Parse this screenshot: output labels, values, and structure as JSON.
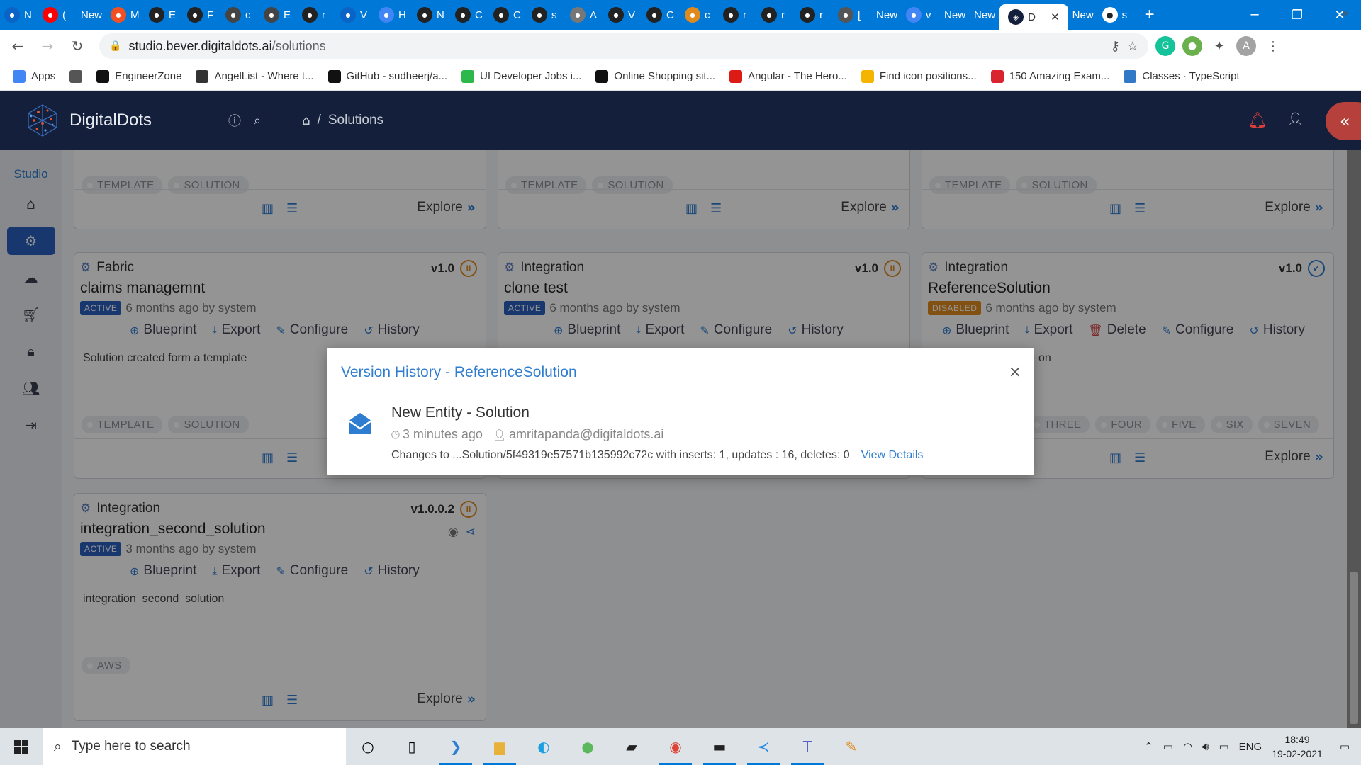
{
  "browser": {
    "tabs": [
      {
        "label": "N",
        "icon": "outlook-icon",
        "color": "#0a64c8"
      },
      {
        "label": "(",
        "icon": "youtube-icon",
        "color": "#ff0000"
      },
      {
        "label": "New",
        "icon": "none",
        "color": ""
      },
      {
        "label": "M",
        "icon": "microsoft-icon",
        "color": "#f25022"
      },
      {
        "label": "E",
        "icon": "github-icon",
        "color": "#222"
      },
      {
        "label": "F",
        "icon": "hub-icon",
        "color": "#222"
      },
      {
        "label": "c",
        "icon": "app-icon",
        "color": "#444"
      },
      {
        "label": "E",
        "icon": "table-icon",
        "color": "#444"
      },
      {
        "label": "r",
        "icon": "github-icon",
        "color": "#222"
      },
      {
        "label": "V",
        "icon": "vscode-icon",
        "color": "#0a64c8"
      },
      {
        "label": "H",
        "icon": "google-icon",
        "color": "#4285f4"
      },
      {
        "label": "N",
        "icon": "github-icon",
        "color": "#222"
      },
      {
        "label": "C",
        "icon": "github-icon",
        "color": "#222"
      },
      {
        "label": "C",
        "icon": "github-icon",
        "color": "#222"
      },
      {
        "label": "s",
        "icon": "github-icon",
        "color": "#222"
      },
      {
        "label": "A",
        "icon": "globe-icon",
        "color": "#777"
      },
      {
        "label": "V",
        "icon": "diamond-icon",
        "color": "#222"
      },
      {
        "label": "C",
        "icon": "github-icon",
        "color": "#222"
      },
      {
        "label": "c",
        "icon": "stack-icon",
        "color": "#e08a1e"
      },
      {
        "label": "r",
        "icon": "github-icon",
        "color": "#222"
      },
      {
        "label": "r",
        "icon": "github-icon",
        "color": "#222"
      },
      {
        "label": "r",
        "icon": "github-icon",
        "color": "#222"
      },
      {
        "label": "[",
        "icon": "star-icon",
        "color": "#555"
      },
      {
        "label": "New",
        "icon": "none",
        "color": ""
      },
      {
        "label": "v",
        "icon": "google-icon",
        "color": "#4285f4"
      },
      {
        "label": "New",
        "icon": "none",
        "color": ""
      },
      {
        "label": "New",
        "icon": "none",
        "color": ""
      }
    ],
    "active_tab": {
      "label": "D",
      "close": "✕"
    },
    "after_tabs": [
      {
        "label": "New",
        "icon": "none"
      },
      {
        "label": "s",
        "icon": "github-icon"
      }
    ],
    "url_host": "studio.bever.digitaldots.ai",
    "url_path": "/solutions",
    "bookmarks": [
      {
        "label": "Apps",
        "icon": "apps-icon",
        "color": "#4285f4"
      },
      {
        "label": "",
        "icon": "globe-icon",
        "color": "#555"
      },
      {
        "label": "EngineerZone",
        "icon": "play-icon",
        "color": "#111"
      },
      {
        "label": "AngelList - Where t...",
        "icon": "angel-icon",
        "color": "#333"
      },
      {
        "label": "GitHub - sudheerj/a...",
        "icon": "github-icon",
        "color": "#111"
      },
      {
        "label": "UI Developer Jobs i...",
        "icon": "bookmark-icon",
        "color": "#2db84b"
      },
      {
        "label": "Online Shopping sit...",
        "icon": "amazon-icon",
        "color": "#111"
      },
      {
        "label": "Angular - The Hero...",
        "icon": "angular-icon",
        "color": "#dd1b16"
      },
      {
        "label": "Find icon positions...",
        "icon": "g-icon",
        "color": "#f4b400"
      },
      {
        "label": "150 Amazing Exam...",
        "icon": "wd-icon",
        "color": "#d9232e"
      },
      {
        "label": "Classes · TypeScript",
        "icon": "ts-icon",
        "color": "#3178c6"
      }
    ],
    "bookmarks_more": "»"
  },
  "app": {
    "brand": "DigitalDots",
    "breadcrumb_current": "Solutions",
    "breadcrumb_sep": "/",
    "sidebar_title": "Studio"
  },
  "cards": [
    {
      "tags": [
        "TEMPLATE",
        "SOLUTION"
      ],
      "explore": "Explore"
    },
    {
      "tags": [
        "TEMPLATE",
        "SOLUTION"
      ],
      "explore": "Explore"
    },
    {
      "tags": [
        "TEMPLATE",
        "SOLUTION"
      ],
      "explore": "Explore"
    },
    {
      "type": "Fabric",
      "version": "v1.0",
      "name": "claims managemnt",
      "status": "ACTIVE",
      "meta": "6 months ago by system",
      "actions": [
        "Blueprint",
        "Export",
        "Configure",
        "History"
      ],
      "description": "Solution created form a template",
      "tags": [
        "TEMPLATE",
        "SOLUTION"
      ]
    },
    {
      "type": "Integration",
      "version": "v1.0",
      "name": "clone test",
      "status": "ACTIVE",
      "meta": "6 months ago by system",
      "actions": [
        "Blueprint",
        "Export",
        "Configure",
        "History"
      ]
    },
    {
      "type": "Integration",
      "version": "v1.0",
      "name": "ReferenceSolution",
      "status": "DISABLED",
      "meta": "6 months ago by system",
      "actions": [
        "Blueprint",
        "Export",
        "Delete",
        "Configure",
        "History"
      ],
      "description_fragment": "on",
      "tags": [
        "THREE",
        "FOUR",
        "FIVE",
        "SIX",
        "SEVEN"
      ],
      "explore": "Explore"
    },
    {
      "type": "Integration",
      "version": "v1.0.0.2",
      "name": "integration_second_solution",
      "status": "ACTIVE",
      "meta": "3 months ago by system",
      "actions": [
        "Blueprint",
        "Export",
        "Configure",
        "History"
      ],
      "description": "integration_second_solution",
      "tags": [
        "AWS"
      ],
      "explore": "Explore"
    }
  ],
  "modal": {
    "title": "Version History - ReferenceSolution",
    "close": "×",
    "entry": {
      "title": "New Entity - Solution",
      "time": "3 minutes ago",
      "user": "amritapanda@digitaldots.ai",
      "changes": "Changes to ...Solution/5f49319e57571b135992c72c with inserts: 1, updates : 16, deletes: 0",
      "link": "View Details"
    }
  },
  "taskbar": {
    "search_placeholder": "Type here to search",
    "lang": "ENG",
    "time": "18:49",
    "date": "19-02-2021"
  },
  "colors": {
    "header_bg": "#14203b",
    "accent": "#2e7dd1",
    "active_badge": "#2c5fbf",
    "disabled_badge": "#e08a1e",
    "pause_ring": "#e08a1e",
    "danger": "#d23b3b"
  }
}
